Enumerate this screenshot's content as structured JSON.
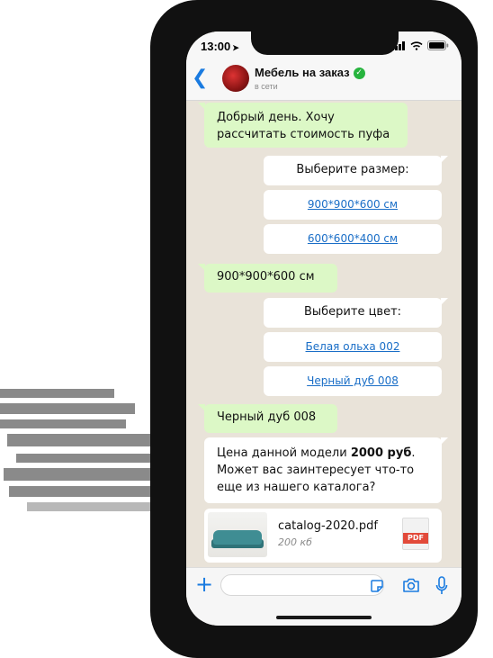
{
  "status_bar": {
    "time": "13:00",
    "location_glyph": "➤"
  },
  "header": {
    "back_glyph": "❮",
    "title": "Мебель на заказ",
    "verified_glyph": "✓",
    "subtitle": "в сети"
  },
  "messages": [
    {
      "type": "out",
      "text": "Добрый день. Хочу рассчитать стоимость пуфа"
    },
    {
      "type": "in",
      "text": "Выберите размер:"
    },
    {
      "type": "option",
      "text": "900*900*600 см"
    },
    {
      "type": "option",
      "text": "600*600*400 см"
    },
    {
      "type": "out",
      "text": "900*900*600 см"
    },
    {
      "type": "in",
      "text": "Выберите цвет:"
    },
    {
      "type": "option",
      "text": "Белая ольха 002"
    },
    {
      "type": "option",
      "text": "Черный дуб 008"
    },
    {
      "type": "out",
      "text": "Черный дуб 008"
    },
    {
      "type": "in",
      "text_before": "Цена данной модели ",
      "text_bold": "2000 руб",
      "text_after": ". Может вас заинтересует что-то еще из нашего каталога?"
    }
  ],
  "attachment": {
    "file_name": "catalog-2020.pdf",
    "file_size": "200 кб",
    "badge": "PDF"
  },
  "composer": {
    "plus_glyph": "+",
    "placeholder": ""
  },
  "colors": {
    "accent": "#1a7be0",
    "outgoing": "#dcf8c6",
    "incoming": "#ffffff",
    "link": "#1a6ec7",
    "verified": "#27b43e",
    "pdf": "#e24a3a"
  }
}
